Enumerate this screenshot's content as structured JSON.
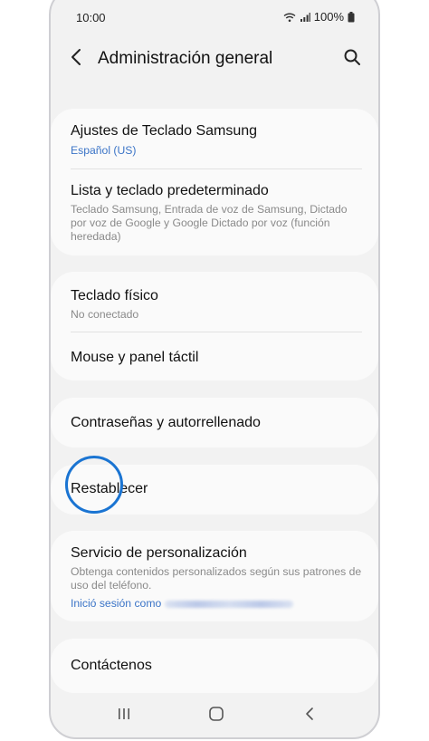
{
  "status_bar": {
    "time": "10:00",
    "battery": "100%"
  },
  "header": {
    "title": "Administración general"
  },
  "sections": [
    {
      "items": [
        {
          "title": "Ajustes de Teclado Samsung",
          "subtitle": "Español (US)"
        },
        {
          "title": "Lista y teclado predeterminado",
          "subtitle": "Teclado Samsung, Entrada de voz de Samsung, Dictado por voz de Google y Google Dictado por voz (función heredada)"
        }
      ]
    },
    {
      "items": [
        {
          "title": "Teclado físico",
          "subtitle": "No conectado"
        },
        {
          "title": "Mouse y panel táctil"
        }
      ]
    },
    {
      "items": [
        {
          "title": "Contraseñas y autorrellenado"
        }
      ]
    },
    {
      "items": [
        {
          "title": "Restablecer"
        }
      ]
    },
    {
      "items": [
        {
          "title": "Servicio de personalización",
          "subtitle": "Obtenga contenidos personalizados según sus patrones de uso del teléfono.",
          "signin": "Inició sesión como"
        }
      ]
    },
    {
      "items": [
        {
          "title": "Contáctenos"
        }
      ]
    }
  ],
  "colors": {
    "accent": "#1a74d2",
    "link": "#3b74c7",
    "background": "#f2f2f2",
    "card": "#fafafa"
  },
  "icons": [
    "wifi-icon",
    "signal-icon",
    "battery-icon",
    "back-arrow-icon",
    "search-icon",
    "recents-icon",
    "home-icon",
    "nav-back-icon"
  ]
}
